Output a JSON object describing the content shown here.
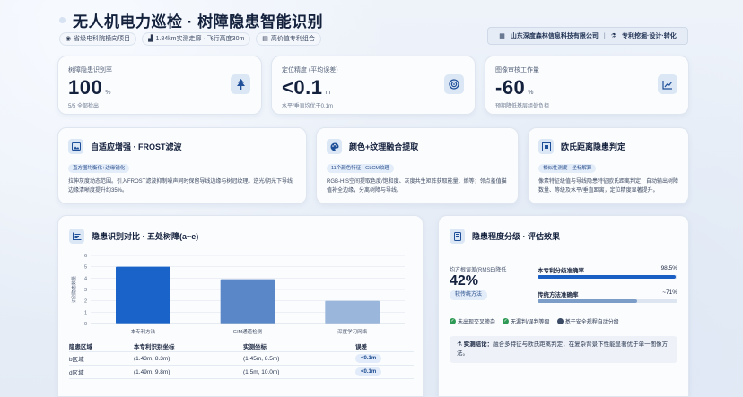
{
  "header": {
    "title": "无人机电力巡检 · 树障隐患智能识别",
    "tags": [
      {
        "icon": "globe-icon",
        "label": "省级电科院横向项目"
      },
      {
        "icon": "chart-icon",
        "label": "1.84km实测走廊 · 飞行高度30m"
      },
      {
        "icon": "document-icon",
        "label": "高价值专利组合"
      }
    ],
    "company": "山东深度森林信息科技有限公司",
    "separator": "|",
    "company_service": "专利挖掘·设计·转化"
  },
  "stats": [
    {
      "label": "树障隐患识别率",
      "value": "100",
      "unit": "%",
      "sub": "5/5 全部检出",
      "icon": "tree-icon"
    },
    {
      "label": "定位精度 (平均误差)",
      "value": "<0.1",
      "unit": "m",
      "sub": "水平/垂直均优于0.1m",
      "icon": "target-icon"
    },
    {
      "label": "图像审核工作量",
      "value": "-60",
      "unit": "%",
      "sub": "预期降低基层组处负担",
      "icon": "trend-icon"
    }
  ],
  "features": [
    {
      "title": "自适应增强 · FROST滤波",
      "pill": "直方图均衡化+边缘锐化",
      "desc": "拉伸灰度动态范围。引入FROST滤波抑制噪声同时保留导线边缘与树冠纹理。逆光/阴光下导线边缘清晰度提升约35%。",
      "icon": "image-icon"
    },
    {
      "title": "颜色+纹理融合提取",
      "pill": "11个颜色特征 · GLCM纹理",
      "desc": "RGB-HIS空间提取色度/饱和度、灰度共生矩阵获取能量、熵等；邻点羞值描值补全边缘，分离树障与导线。",
      "icon": "palette-icon"
    },
    {
      "title": "欧氏距离隐患判定",
      "pill": "相似性测度 · 坐标解算",
      "desc": "像素特征级值与导线隐患特征欧氏距离判定，自动输出树障数量、等级及水平/垂直距离，定位精度显著提升。",
      "icon": "grid-icon"
    }
  ],
  "comparison": {
    "title": "隐患识别对比 · 五处树障(a~e)",
    "icon": "list-icon",
    "table": {
      "headers": [
        "隐患区域",
        "本专利识别坐标",
        "实测坐标",
        "误差"
      ],
      "rows": [
        [
          "b区域",
          "(1.43m, 8.3m)",
          "(1.45m, 8.5m)",
          "<0.1m"
        ],
        [
          "d区域",
          "(1.49m, 9.8m)",
          "(1.5m, 10.0m)",
          "<0.1m"
        ]
      ]
    }
  },
  "chart_data": {
    "type": "bar",
    "categories": [
      "本专利方法",
      "GIM通道检测",
      "深度学习网络"
    ],
    "values": [
      5,
      3.9,
      2
    ],
    "ylabel": "识别隐患数量",
    "ylim": [
      0,
      6
    ],
    "yticks": [
      0,
      1,
      2,
      3,
      4,
      5,
      6
    ],
    "grid": true,
    "colors": [
      "#1a63c9",
      "#5a87c7",
      "#9bb6db"
    ]
  },
  "evaluation": {
    "title": "隐患程度分级 · 评估效果",
    "icon": "bookmark-icon",
    "rmse_label": "均方根误差(RMSE)降低",
    "rmse_value": "42%",
    "rmse_pill": "较传统方法",
    "bars": [
      {
        "label": "本专利分级准确率",
        "value_text": "98.5%",
        "value": 98.5,
        "color": "#1a5fc4"
      },
      {
        "label": "传统方法准确率",
        "value_text": "~71%",
        "value": 71,
        "color": "#7d9dc9"
      }
    ],
    "checks": [
      "未出现交叉掺杂",
      "无漏判/误判等级",
      "基于安全规程自动分级"
    ],
    "conclusion_label": "实测结论：",
    "conclusion_text": "融合多特征与欧氏距离判定，在复杂背景下性能显著优于单一图像方法。"
  }
}
